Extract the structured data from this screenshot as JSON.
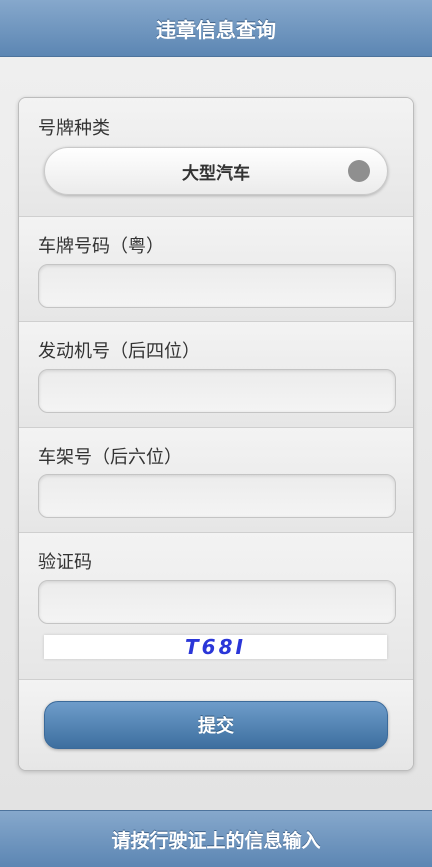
{
  "header": {
    "title": "违章信息查询"
  },
  "form": {
    "plate_type": {
      "label": "号牌种类",
      "selected": "大型汽车"
    },
    "plate_number": {
      "label": "车牌号码（粤）",
      "value": ""
    },
    "engine_number": {
      "label": "发动机号（后四位）",
      "value": ""
    },
    "frame_number": {
      "label": "车架号（后六位）",
      "value": ""
    },
    "captcha": {
      "label": "验证码",
      "value": "",
      "image_text": "T68I"
    },
    "submit_label": "提交"
  },
  "footer": {
    "text": "请按行驶证上的信息输入"
  },
  "colors": {
    "header_bar": "#6f95bf",
    "submit_button": "#4f80b2",
    "captcha_text": "#2a36d8"
  }
}
